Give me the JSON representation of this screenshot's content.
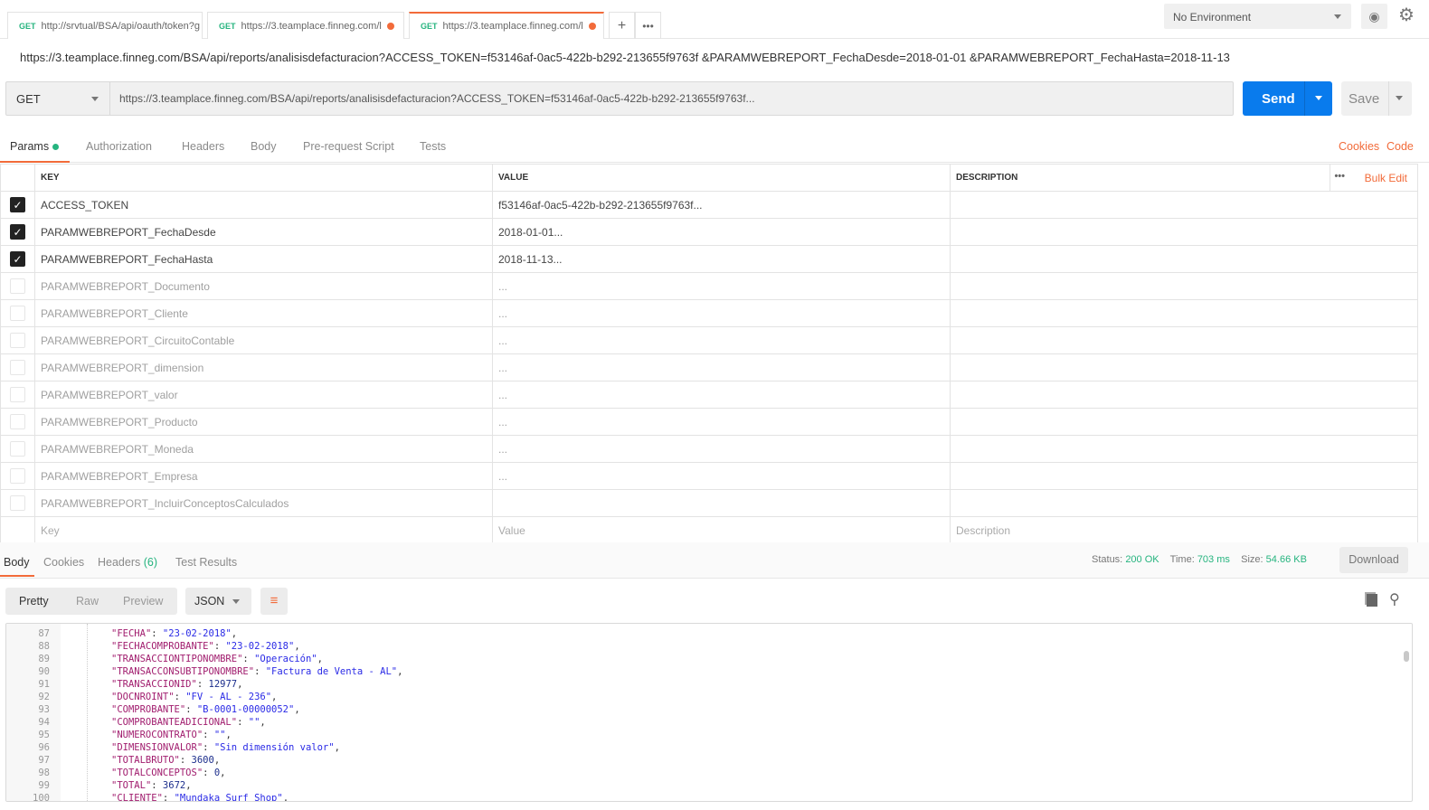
{
  "tabs": [
    {
      "method": "GET",
      "label": "http://srvtual/BSA/api/oauth/token?g",
      "dirty": false
    },
    {
      "method": "GET",
      "label": "https://3.teamplace.finneg.com/l",
      "dirty": true
    },
    {
      "method": "GET",
      "label": "https://3.teamplace.finneg.com/l",
      "dirty": true
    }
  ],
  "environment": "No Environment",
  "request_title": "https://3.teamplace.finneg.com/BSA/api/reports/analisisdefacturacion?ACCESS_TOKEN=f53146af-0ac5-422b-b292-213655f9763f &PARAMWEBREPORT_FechaDesde=2018-01-01 &PARAMWEBREPORT_FechaHasta=2018-11-13",
  "method": "GET",
  "url": "https://3.teamplace.finneg.com/BSA/api/reports/analisisdefacturacion?ACCESS_TOKEN=f53146af-0ac5-422b-b292-213655f9763f...",
  "send_label": "Send",
  "save_label": "Save",
  "req_tabs": [
    "Params",
    "Authorization",
    "Headers",
    "Body",
    "Pre-request Script",
    "Tests"
  ],
  "cookies_link": "Cookies",
  "code_link": "Code",
  "table": {
    "headers": [
      "KEY",
      "VALUE",
      "DESCRIPTION"
    ],
    "bulk_edit": "Bulk Edit",
    "rows": [
      {
        "checked": true,
        "key": "ACCESS_TOKEN",
        "value": "f53146af-0ac5-422b-b292-213655f9763f..."
      },
      {
        "checked": true,
        "key": "PARAMWEBREPORT_FechaDesde",
        "value": "2018-01-01..."
      },
      {
        "checked": true,
        "key": "PARAMWEBREPORT_FechaHasta",
        "value": "2018-11-13..."
      },
      {
        "checked": false,
        "key": "PARAMWEBREPORT_Documento",
        "value": "..."
      },
      {
        "checked": false,
        "key": "PARAMWEBREPORT_Cliente",
        "value": "..."
      },
      {
        "checked": false,
        "key": "PARAMWEBREPORT_CircuitoContable",
        "value": "..."
      },
      {
        "checked": false,
        "key": "PARAMWEBREPORT_dimension",
        "value": "..."
      },
      {
        "checked": false,
        "key": "PARAMWEBREPORT_valor",
        "value": "..."
      },
      {
        "checked": false,
        "key": "PARAMWEBREPORT_Producto",
        "value": "..."
      },
      {
        "checked": false,
        "key": "PARAMWEBREPORT_Moneda",
        "value": "..."
      },
      {
        "checked": false,
        "key": "PARAMWEBREPORT_Empresa",
        "value": "..."
      },
      {
        "checked": false,
        "key": "PARAMWEBREPORT_IncluirConceptosCalculados",
        "value": ""
      }
    ],
    "placeholders": {
      "key": "Key",
      "value": "Value",
      "description": "Description"
    }
  },
  "response": {
    "tabs": [
      "Body",
      "Cookies",
      "Headers",
      "Test Results"
    ],
    "headers_count": "(6)",
    "status_label": "Status:",
    "status": "200 OK",
    "time_label": "Time:",
    "time": "703 ms",
    "size_label": "Size:",
    "size": "54.66 KB",
    "download": "Download",
    "views": [
      "Pretty",
      "Raw",
      "Preview"
    ],
    "format": "JSON"
  },
  "code": [
    {
      "n": "87",
      "k": "FECHA",
      "v": "\"23-02-2018\"",
      "t": "s"
    },
    {
      "n": "88",
      "k": "FECHACOMPROBANTE",
      "v": "\"23-02-2018\"",
      "t": "s"
    },
    {
      "n": "89",
      "k": "TRANSACCIONTIPONOMBRE",
      "v": "\"Operación\"",
      "t": "s"
    },
    {
      "n": "90",
      "k": "TRANSACCONSUBTIPONOMBRE",
      "v": "\"Factura de Venta - AL\"",
      "t": "s"
    },
    {
      "n": "91",
      "k": "TRANSACCIONID",
      "v": "12977",
      "t": "n"
    },
    {
      "n": "92",
      "k": "DOCNROINT",
      "v": "\"FV - AL - 236\"",
      "t": "s"
    },
    {
      "n": "93",
      "k": "COMPROBANTE",
      "v": "\"B-0001-00000052\"",
      "t": "s"
    },
    {
      "n": "94",
      "k": "COMPROBANTEADICIONAL",
      "v": "\"\"",
      "t": "s"
    },
    {
      "n": "95",
      "k": "NUMEROCONTRATO",
      "v": "\"\"",
      "t": "s"
    },
    {
      "n": "96",
      "k": "DIMENSIONVALOR",
      "v": "\"Sin dimensión valor\"",
      "t": "s"
    },
    {
      "n": "97",
      "k": "TOTALBRUTO",
      "v": "3600",
      "t": "n"
    },
    {
      "n": "98",
      "k": "TOTALCONCEPTOS",
      "v": "0",
      "t": "n"
    },
    {
      "n": "99",
      "k": "TOTAL",
      "v": "3672",
      "t": "n"
    },
    {
      "n": "100",
      "k": "CLIENTE",
      "v": "\"Mundaka Surf Shop\"",
      "t": "s"
    }
  ]
}
